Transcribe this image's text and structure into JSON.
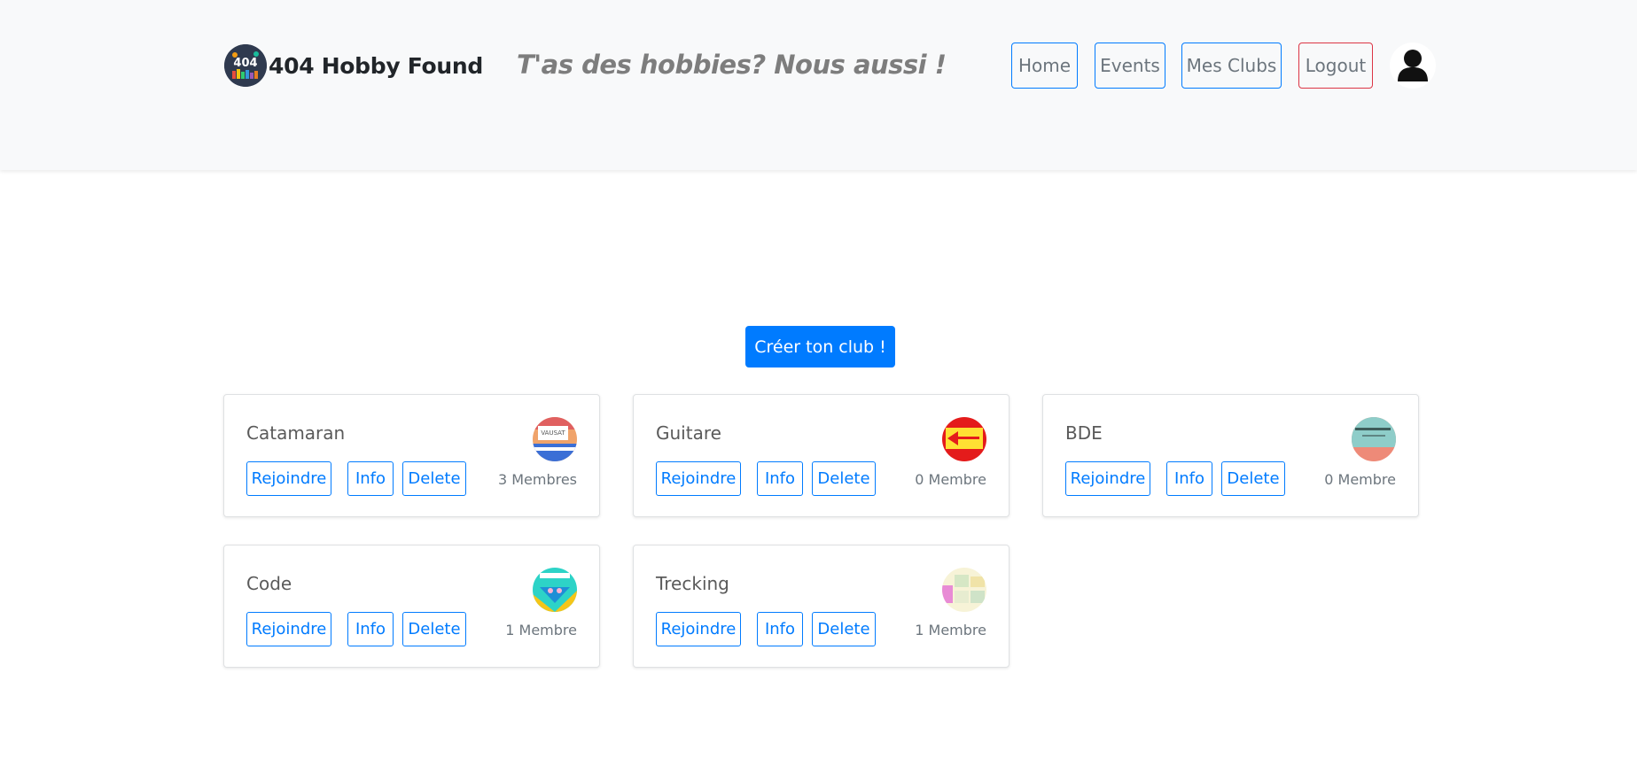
{
  "brand": {
    "name": "404 Hobby Found",
    "logo_text": "404",
    "logo_icon": "brand-logo"
  },
  "tagline": "T'as des hobbies? Nous aussi !",
  "nav": {
    "home": "Home",
    "events": "Events",
    "clubs": "Mes Clubs",
    "logout": "Logout",
    "profile_icon": "user-icon"
  },
  "create_button": "Créer ton club !",
  "colors": {
    "primary": "#007bff",
    "danger": "#dc3545",
    "navbar_bg": "#f8f9fa",
    "muted": "#6c757d"
  },
  "clubs": [
    {
      "name": "Catamaran",
      "join": "Rejoindre",
      "info": "Info",
      "delete": "Delete",
      "members": "3 Membres",
      "image_text": "VAUSAT"
    },
    {
      "name": "Guitare",
      "join": "Rejoindre",
      "info": "Info",
      "delete": "Delete",
      "members": "0 Membre"
    },
    {
      "name": "BDE",
      "join": "Rejoindre",
      "info": "Info",
      "delete": "Delete",
      "members": "0 Membre"
    },
    {
      "name": "Code",
      "join": "Rejoindre",
      "info": "Info",
      "delete": "Delete",
      "members": "1 Membre"
    },
    {
      "name": "Trecking",
      "join": "Rejoindre",
      "info": "Info",
      "delete": "Delete",
      "members": "1 Membre"
    }
  ]
}
